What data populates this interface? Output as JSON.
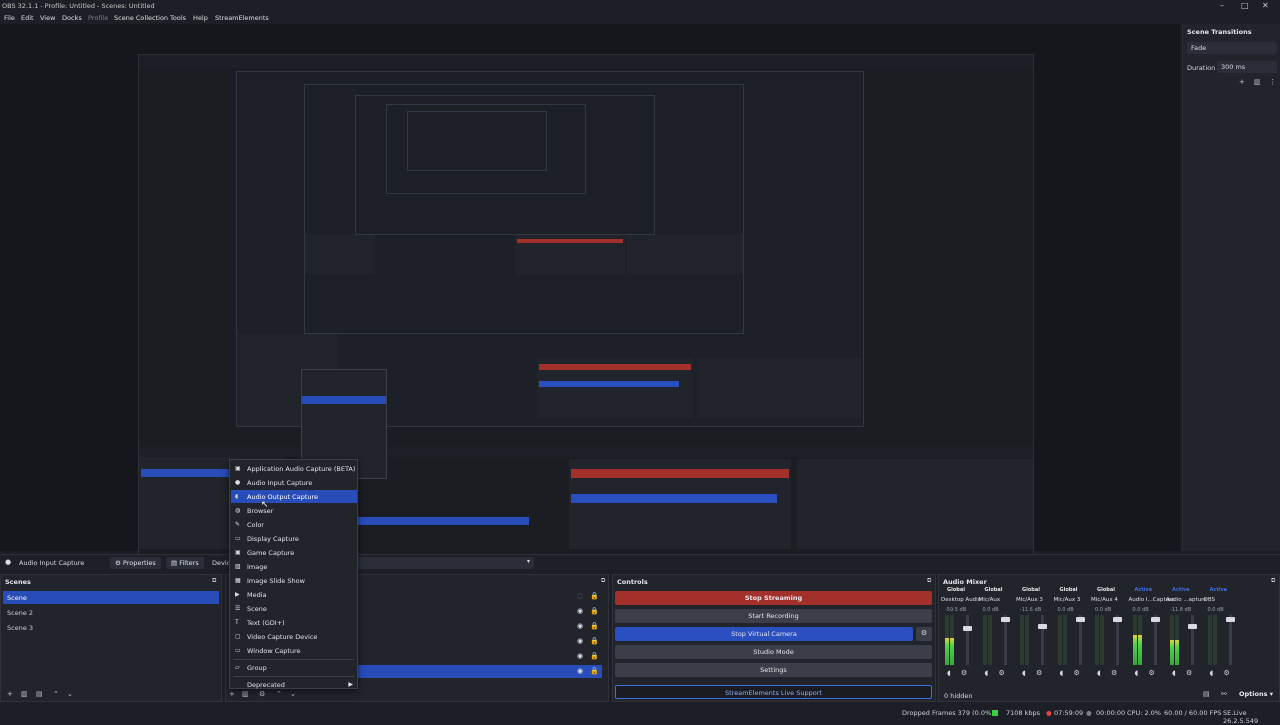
{
  "window": {
    "title": "OBS 32.1.1 - Profile: Untitled - Scenes: Untitled",
    "min": "–",
    "max": "□",
    "close": "✕"
  },
  "menu": [
    "File",
    "Edit",
    "View",
    "Docks",
    "Profile",
    "Scene Collection",
    "Tools",
    "Help",
    "StreamElements"
  ],
  "transitions": {
    "title": "Scene Transitions",
    "selected": "Fade",
    "duration_label": "Duration",
    "duration_value": "300 ms"
  },
  "source_bar": {
    "source_name": "Audio Input Capture",
    "properties": "Properties",
    "filters": "Filters",
    "device": "Devic"
  },
  "scenes": {
    "title": "Scenes",
    "items": [
      "Scene",
      "Scene 2",
      "Scene 3"
    ]
  },
  "context_menu": {
    "items": [
      {
        "label": "Application Audio Capture (BETA)",
        "icon": "app-audio-icon"
      },
      {
        "label": "Audio Input Capture",
        "icon": "microphone-icon"
      },
      {
        "label": "Audio Output Capture",
        "icon": "speaker-icon"
      },
      {
        "label": "Browser",
        "icon": "globe-icon"
      },
      {
        "label": "Color",
        "icon": "brush-icon"
      },
      {
        "label": "Display Capture",
        "icon": "monitor-icon"
      },
      {
        "label": "Game Capture",
        "icon": "gamepad-icon"
      },
      {
        "label": "Image",
        "icon": "image-icon"
      },
      {
        "label": "Image Slide Show",
        "icon": "slideshow-icon"
      },
      {
        "label": "Media",
        "icon": "play-icon"
      },
      {
        "label": "Scene",
        "icon": "list-icon"
      },
      {
        "label": "Text (GDI+)",
        "icon": "text-icon"
      },
      {
        "label": "Video Capture Device",
        "icon": "camera-icon"
      },
      {
        "label": "Window Capture",
        "icon": "window-icon"
      },
      {
        "label": "Group",
        "icon": "folder-icon"
      },
      {
        "label": "Deprecated",
        "icon": ""
      }
    ]
  },
  "controls": {
    "title": "Controls",
    "stop_streaming": "Stop Streaming",
    "start_recording": "Start Recording",
    "stop_virtual_camera": "Stop Virtual Camera",
    "studio_mode": "Studio Mode",
    "settings": "Settings",
    "se_live_support": "StreamElements Live Support"
  },
  "audio_mixer": {
    "title": "Audio Mixer",
    "channels": [
      {
        "name": "Desktop Audio",
        "tag": "Global",
        "db": "-59.5 dB",
        "level": 0.55,
        "volume": 0.75
      },
      {
        "name": "Mic/Aux",
        "tag": "Global",
        "db": "0.0 dB",
        "level": 0.0,
        "volume": 0.95
      },
      {
        "name": "Mic/Aux 3",
        "tag": "Global",
        "db": "-11.6 dB",
        "level": 0.0,
        "volume": 0.8
      },
      {
        "name": "Mic/Aux 3",
        "tag": "Global",
        "db": "0.0 dB",
        "level": 0.0,
        "volume": 0.95
      },
      {
        "name": "Mic/Aux 4",
        "tag": "Global",
        "db": "0.0 dB",
        "level": 0.0,
        "volume": 0.95
      },
      {
        "name": "Audio I...Capture",
        "tag": "Active",
        "db": "0.0 dB",
        "level": 0.6,
        "volume": 0.95
      },
      {
        "name": "Audio ...apture",
        "tag": "Active",
        "db": "-11.8 dB",
        "level": 0.5,
        "volume": 0.8
      },
      {
        "name": "OBS",
        "tag": "Active",
        "db": "0.0 dB",
        "level": 0.0,
        "volume": 0.95
      }
    ],
    "hidden": "0 hidden",
    "options": "Options"
  },
  "status": {
    "dropped": "Dropped Frames 379 (0.0%)",
    "kbps": "7108 kbps",
    "stream_time": "07:59:09",
    "rec_time": "00:00:00",
    "cpu": "CPU: 2.0%",
    "fps": "60.00 / 60.00 FPS",
    "version": "SE.Live 26.2.5.549"
  },
  "colors": {
    "accent": "#284cb8",
    "stop_red": "#a3302a",
    "bg": "#1d1f26"
  }
}
